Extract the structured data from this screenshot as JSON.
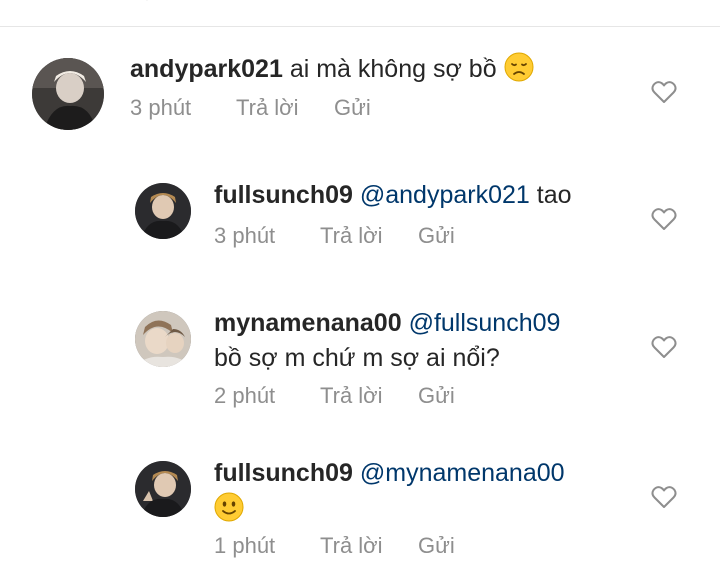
{
  "comments": [
    {
      "username": "andypark021",
      "mention": "",
      "text": "ai mà không sợ bồ",
      "emoji": "disappointed-face",
      "time": "3 phút",
      "reply_label": "Trả lời",
      "send_label": "Gửi"
    },
    {
      "username": "fullsunch09",
      "mention": "@andypark021",
      "text": "tao",
      "emoji": "",
      "time": "3 phút",
      "reply_label": "Trả lời",
      "send_label": "Gửi"
    },
    {
      "username": "mynamenana00",
      "mention": "@fullsunch09",
      "text": "bồ sợ m chứ m sợ ai nổi?",
      "emoji": "",
      "time": "2 phút",
      "reply_label": "Trả lời",
      "send_label": "Gửi"
    },
    {
      "username": "fullsunch09",
      "mention": "@mynamenana00",
      "text": "",
      "emoji": "slightly-smiling-face",
      "time": "1 phút",
      "reply_label": "Trả lời",
      "send_label": "Gửi"
    }
  ],
  "icons": {
    "like": "heart-outline-icon"
  },
  "colors": {
    "text": "#262626",
    "mention": "#00376b",
    "meta": "#8e8e8e",
    "divider": "#e6e6e6"
  }
}
